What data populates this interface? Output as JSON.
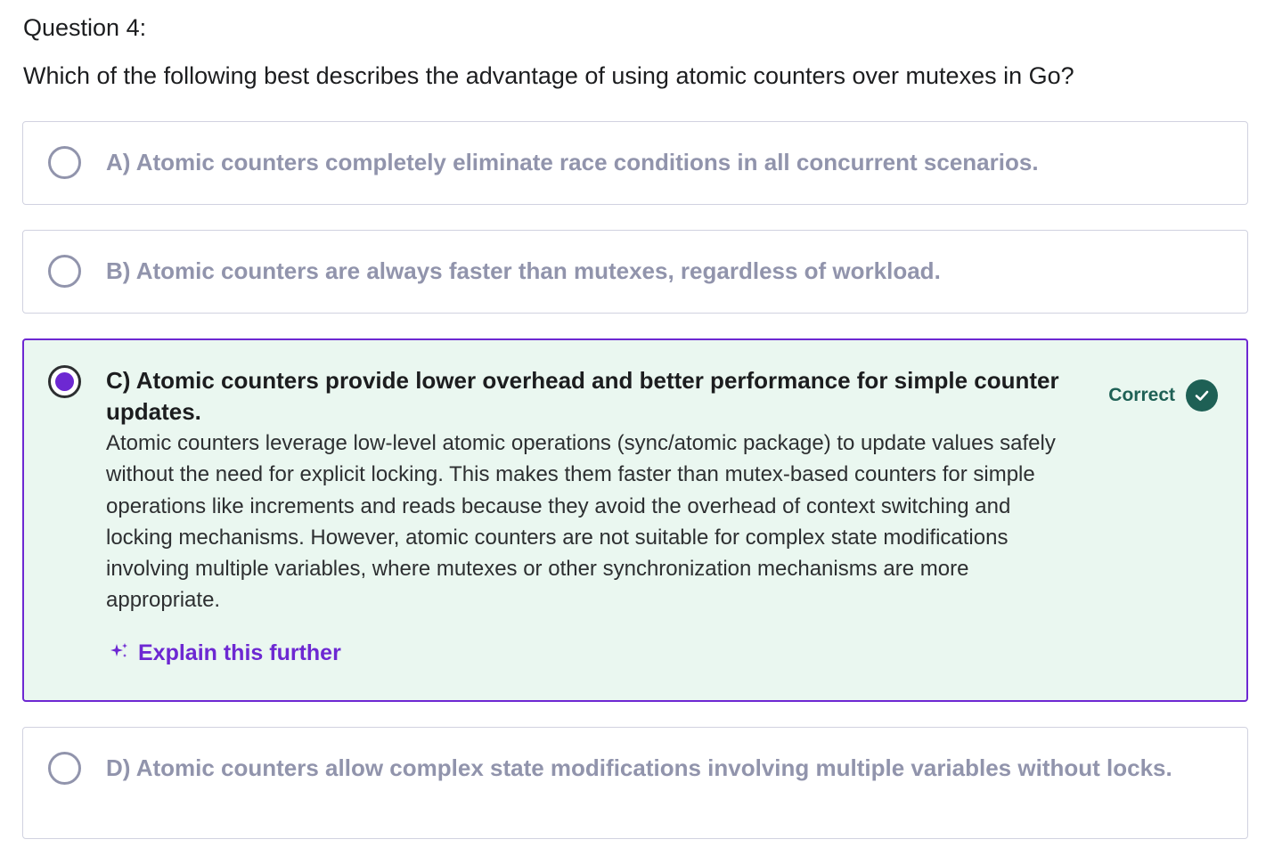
{
  "question": {
    "number": "Question 4:",
    "text": "Which of the following best describes the advantage of using atomic counters over mutexes in Go?"
  },
  "options": [
    {
      "label": "A) Atomic counters completely eliminate race conditions in all concurrent scenarios.",
      "selected": false
    },
    {
      "label": "B) Atomic counters are always faster than mutexes, regardless of workload.",
      "selected": false
    },
    {
      "label": "C) Atomic counters provide lower overhead and better performance for simple counter updates.",
      "selected": true,
      "status": "Correct",
      "explanation": "Atomic counters leverage low-level atomic operations (sync/atomic package) to update values safely without the need for explicit locking. This makes them faster than mutex-based counters for simple operations like increments and reads because they avoid the overhead of context switching and locking mechanisms. However, atomic counters are not suitable for complex state modifications involving multiple variables, where mutexes or other synchronization mechanisms are more appropriate.",
      "explain_further": "Explain this further"
    },
    {
      "label": "D) Atomic counters allow complex state modifications involving multiple variables without locks.",
      "selected": false
    }
  ],
  "colors": {
    "accent": "#6d28d2",
    "correct": "#1e6055",
    "correct_bg": "#eaf7f0",
    "muted": "#9194ac"
  },
  "icons": {
    "selected_radio": "radio-selected-icon",
    "unselected_radio": "radio-unselected-icon",
    "correct": "check-circle-icon",
    "explain": "sparkle-icon"
  }
}
